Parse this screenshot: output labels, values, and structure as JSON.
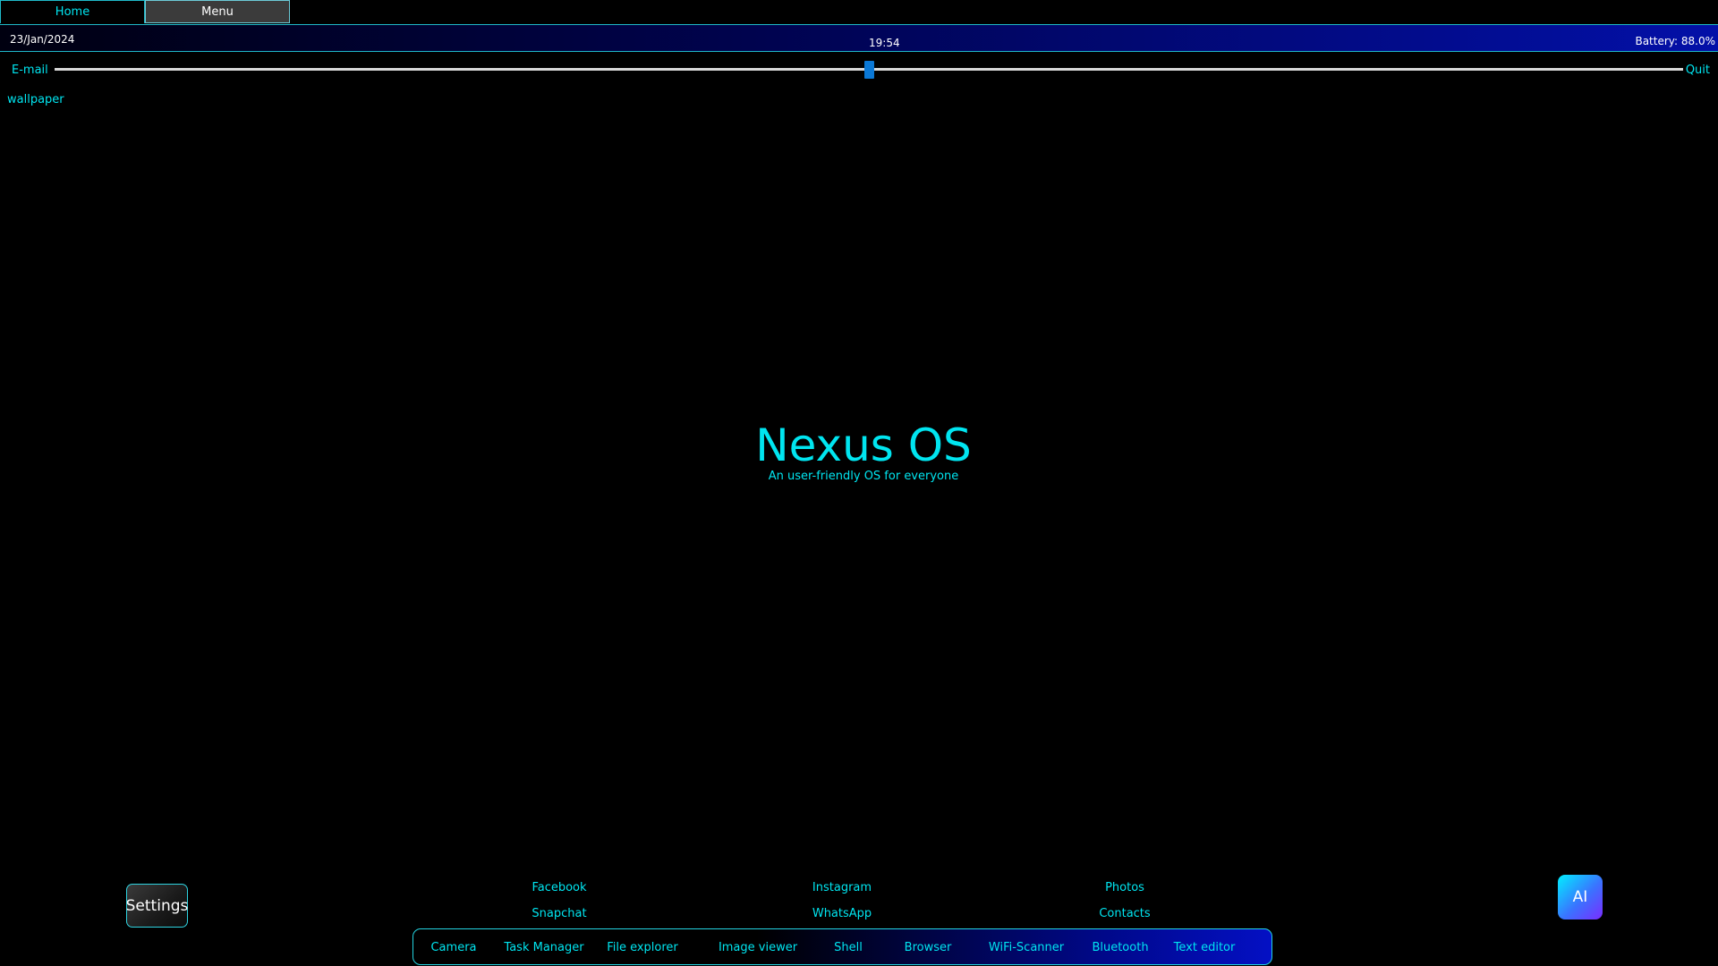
{
  "tabs": {
    "home": "Home",
    "menu": "Menu"
  },
  "status": {
    "date": "23/Jan/2024",
    "time": "19:54",
    "battery": "Battery: 88.0%"
  },
  "links": {
    "email": "E-mail",
    "quit": "Quit",
    "wallpaper": "wallpaper"
  },
  "slider": {
    "value_percent": 50
  },
  "hero": {
    "title": "Nexus OS",
    "subtitle": "An user-friendly OS for everyone"
  },
  "buttons": {
    "settings": "Settings",
    "ai": "AI"
  },
  "social": {
    "row1": [
      "Facebook",
      "Instagram",
      "Photos"
    ],
    "row2": [
      "Snapchat",
      "WhatsApp",
      "Contacts"
    ]
  },
  "dock": [
    "Camera",
    "Task Manager",
    "File explorer",
    "Image viewer",
    "Shell",
    "Browser",
    "WiFi-Scanner",
    "Bluetooth",
    "Text editor"
  ],
  "colors": {
    "accent": "#00e5f0",
    "background": "#000000",
    "statusbar_end": "#0310a8",
    "slider_thumb": "#0a78d6"
  }
}
